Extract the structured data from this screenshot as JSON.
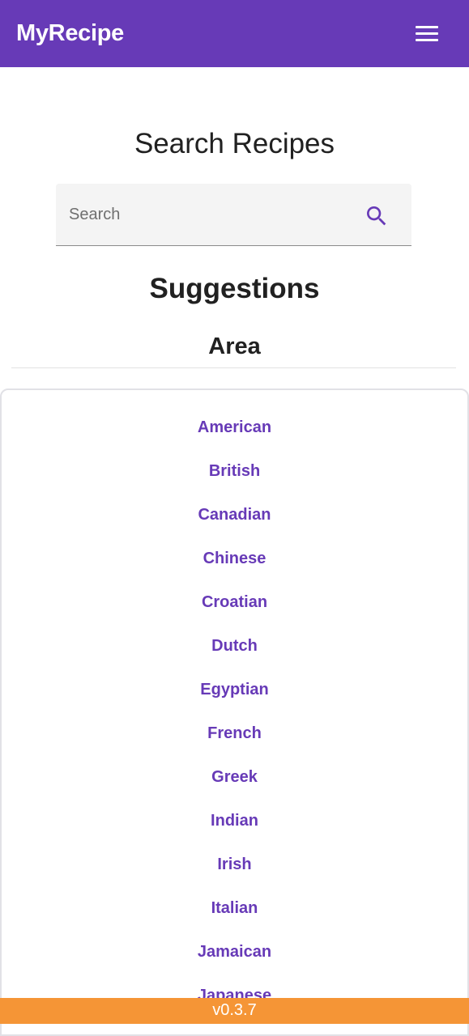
{
  "app": {
    "brand": "MyRecipe",
    "menu_icon": "hamburger-menu-icon"
  },
  "search": {
    "title": "Search Recipes",
    "placeholder": "Search",
    "value": "",
    "button_icon": "search-icon"
  },
  "suggestions": {
    "title": "Suggestions",
    "area_heading": "Area",
    "areas": [
      "American",
      "British",
      "Canadian",
      "Chinese",
      "Croatian",
      "Dutch",
      "Egyptian",
      "French",
      "Greek",
      "Indian",
      "Irish",
      "Italian",
      "Jamaican",
      "Japanese"
    ]
  },
  "footer": {
    "version": "v0.3.7"
  },
  "colors": {
    "primary": "#673ab7",
    "footer": "#f59536"
  }
}
